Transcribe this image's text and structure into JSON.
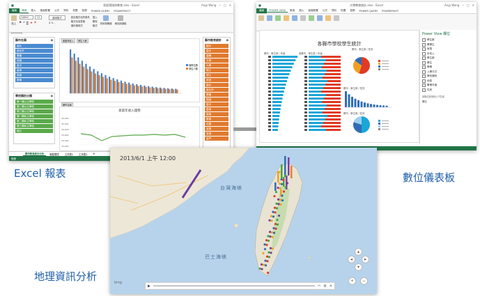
{
  "excel": {
    "title": "家庭環境與教育.xlsx - Excel",
    "user": "Angi Wang",
    "tabs": [
      "檔案",
      "常用",
      "插入",
      "版面配置",
      "公式",
      "資料",
      "校閱",
      "檢視",
      "POWER QUERY",
      "POWERPIVOT"
    ],
    "font_name": "Calibri",
    "font_size": "11",
    "number_format": "通用格式",
    "ribbon_groups": [
      "貼上",
      "B",
      "I",
      "U",
      "設定格式化的條件",
      "格式化為表格",
      "儲存格樣式",
      "插入",
      "刪除",
      "格式",
      "排序與篩選",
      "尋找與選取"
    ],
    "slicer_city": {
      "title": "縣市名稱",
      "items": [
        "臺北",
        "新北市",
        "基隆",
        "桃園",
        "臺中",
        "臺南",
        "高雄",
        "屏東",
        "花蓮",
        "宜蘭",
        "澎湖",
        "金門"
      ]
    },
    "slicer_edu": {
      "title": "縣市教育統計",
      "items": [
        "國中",
        "高中",
        "高職",
        "五專",
        "大學",
        "碩士",
        "博士",
        "其他"
      ]
    },
    "slicer_school": {
      "title": "學校類別分類",
      "items": [
        "第一類公立學校",
        "第二類公立學校",
        "第三類公立學校",
        "第一類私立學校",
        "第二類私立學校",
        "第三類私立學校",
        "國立"
      ]
    },
    "filter_chips": [
      "家庭年收入",
      "學生人數"
    ],
    "chart_legend": [
      "總學生數",
      "學生人數"
    ],
    "filter_btn": "縣市名稱",
    "line_chart_title": "家庭年收入趨勢",
    "line_yticks": [
      "40,000",
      "35,000",
      "30,000",
      "25,000",
      "20,000",
      "15,000"
    ],
    "sheets": [
      "縣市教育統計分析",
      "家庭環境",
      "工作表1",
      "工作表2"
    ],
    "status": "就緒"
  },
  "powerview": {
    "title": "大學教育統計.xlsx - Excel",
    "user": "Angi Wang",
    "tabs": [
      "檔案",
      "POWER VIEW",
      "常用",
      "插入",
      "版面配置",
      "公式",
      "資料",
      "校閱",
      "檢視",
      "POWER QUERY",
      "POWERPIVOT"
    ],
    "report_title": "各縣市學校學生統計",
    "chart1_title": "縣市 - 學生數 / 年級",
    "chart2_title": "各縣市 - 學生數 / 年級",
    "pie1_title": "縣市、學生數 / 性別",
    "pie2_title": "縣市、學生數 / 性別",
    "col_title": "縣市 - 學生數 / 性別",
    "fields_title": "Power View 欄位",
    "field_items": [
      "學生數",
      "畢業生",
      "家庭",
      "年收入",
      "學生數",
      "學生",
      "學期",
      "入學方式",
      "學校類別",
      "地區",
      "畢業年度",
      "性別"
    ],
    "field_hint": "將欄位拖曳到以下區域",
    "field_area": "欄位",
    "legend_labels": [
      "一年級",
      "二年級",
      "三年級",
      "四年級"
    ]
  },
  "geo": {
    "timestamp": "2013/6/1 上午 12:00",
    "label_strait": "台灣海峽",
    "label_bashi": "巴士海峽",
    "logo": "bing"
  },
  "labels": {
    "excel": "Excel 報表",
    "dashboard": "數位儀表板",
    "geo": "地理資訊分析"
  },
  "colors": {
    "excel_green": "#217346",
    "slicer_blue": "#4a8bd0",
    "slicer_green": "#5aaa4a",
    "slicer_orange": "#e07a2e",
    "bar_blue": "#4a7fc1",
    "bar_orange": "#e8822e",
    "pv_cyan": "#1aa6d8",
    "pv_red": "#e03b24"
  }
}
